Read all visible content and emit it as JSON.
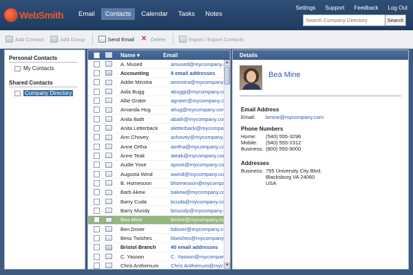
{
  "app": {
    "name": "WebSmith"
  },
  "nav": {
    "items": [
      "Email",
      "Contacts",
      "Calendar",
      "Tasks",
      "Notes"
    ],
    "active": "Contacts"
  },
  "top_links": [
    "Settings",
    "Support",
    "Feedback",
    "Log Out"
  ],
  "search": {
    "placeholder": "Search Company Directory",
    "button": "Search"
  },
  "toolbar": {
    "add_contact": "Add Contact",
    "add_group": "Add Group",
    "send_email": "Send Email",
    "delete": "Delete",
    "import_export": "Import / Export Contacts"
  },
  "sidebar": {
    "personal_heading": "Personal Contacts",
    "personal_items": [
      "My Contacts"
    ],
    "shared_heading": "Shared Contacts",
    "shared_items": [
      "Company Directory"
    ],
    "selected": "Company Directory"
  },
  "list": {
    "col_name": "Name ▾",
    "col_email": "Email",
    "rows": [
      {
        "name": "A. Mused",
        "email": "amused@mycompany.com",
        "type": "contact"
      },
      {
        "name": "Accounting",
        "email": "8 email addresses",
        "type": "group"
      },
      {
        "name": "Addie Minstra",
        "email": "aminstra@mycompany.com",
        "type": "contact"
      },
      {
        "name": "Aida Bugg",
        "email": "abuggi@mycompany.com",
        "type": "contact"
      },
      {
        "name": "Allie Grater",
        "email": "agrater@mycompany.com",
        "type": "contact"
      },
      {
        "name": "Amanda Hug",
        "email": "ahug@mycompany.com",
        "type": "contact"
      },
      {
        "name": "Anita Bath",
        "email": "abath@mycompany.com",
        "type": "contact"
      },
      {
        "name": "Anita Letterback",
        "email": "aletterback@mycompany.com",
        "type": "contact"
      },
      {
        "name": "Ann Chovey",
        "email": "achovey@mycompany.com",
        "type": "contact"
      },
      {
        "name": "Anne Ortha",
        "email": "aortha@mycompany.com",
        "type": "contact"
      },
      {
        "name": "Anne Teak",
        "email": "ateak@mycompany.com",
        "type": "contact"
      },
      {
        "name": "Audie Yose",
        "email": "ayose@mycompany.com",
        "type": "contact"
      },
      {
        "name": "Augusta Wind",
        "email": "awind@mycompany.com",
        "type": "contact"
      },
      {
        "name": "B. Homesoon",
        "email": "bhomesoon@mycompany.com",
        "type": "contact"
      },
      {
        "name": "Barb Akew",
        "email": "bakew@mycompany.com",
        "type": "contact"
      },
      {
        "name": "Barry Cuda",
        "email": "bcuda@mycompany.com",
        "type": "contact"
      },
      {
        "name": "Barry Mundy",
        "email": "bmundy@mycompany.com",
        "type": "contact"
      },
      {
        "name": "Bea Mine",
        "email": "bmine@mycompany.com",
        "type": "contact",
        "selected": true
      },
      {
        "name": "Ben Dover",
        "email": "bdover@mycompany.com",
        "type": "contact"
      },
      {
        "name": "Bess Twishes",
        "email": "btwishes@mycompany.com",
        "type": "contact"
      },
      {
        "name": "Bristol Branch",
        "email": "40 email addresses",
        "type": "group"
      },
      {
        "name": "C. Yasoon",
        "email": "C. Yasoon@mycompany.com",
        "type": "contact"
      },
      {
        "name": "Chris Anthemum",
        "email": "Chris Anthemum@mycompany.com",
        "type": "contact"
      }
    ]
  },
  "details": {
    "heading": "Details",
    "name": "Bea Mine",
    "email_heading": "Email Address",
    "email_label": "Email:",
    "email": "bmine@mycompany.com",
    "phone_heading": "Phone Numbers",
    "home_label": "Home:",
    "home": "(540) 555-3296",
    "mobile_label": "Mobile:",
    "mobile": "(540) 555-2312",
    "business_label": "Business:",
    "business": "(800) 555-9000",
    "address_heading": "Addresses",
    "address_label": "Business:",
    "address_lines": [
      "755 University City Blvd.",
      "Blacksburg VA 24060",
      "USA"
    ]
  },
  "colors": {
    "header": "#1f3b60",
    "accent": "#2b57b8",
    "selected_row": "#96b682",
    "logo": "#e8582c"
  }
}
